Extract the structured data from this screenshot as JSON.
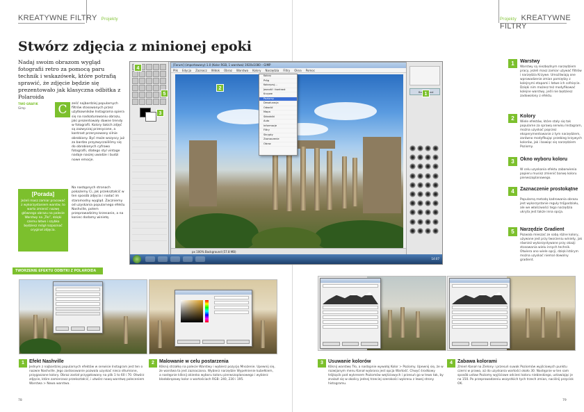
{
  "header": {
    "section": "KREATYWNE FILTRY",
    "subsection": "Projekty"
  },
  "article": {
    "title": "Stwórz zdjęcia z minionej epoki",
    "lead": "Nadaj swoim obrazom wygląd fotografii retro za pomocą paru technik i wskazówek, które potrafią sprawić, że zdjęcie będzie się prezentowało jak klasyczna odbitka z Polaroida",
    "credits_label": "TWÓ GRAFIK",
    "credits_sub": "Gimp",
    "dropcap": "C",
    "body_col1": "ześć najbardziej popularnych filtrów stosowanych przez użytkowników Instagrama opiera się na nadsaturowaniu obrazu, jaki prezentowały dawne trendy w fotografii. Kolory takich zdjęć są zazwyczaj przesycone, a kontrast przerysowany silnie obrobiony. Być może wszyscy już za bardzo przyzwyczailiśmy się do obrobionych cyfrowo fotografii, dlatego styl vintage nadaje naszej uwadze i budzi nowe emocje.",
    "body_col2": "Na następnych stronach pokażemy Ci, jak przekształcić w ten sposób zdjęcia i nadać im staromodny wygląd. Zaczniemy od uzyskania popularnego efektu Nashville, potem przeprowadzimy krzesanie, a na koniec dodamy winietę.",
    "tip_title": "[Porada]",
    "tip_text": "Jeżeli masz zamiar pracować z wykorzystaniem warstw, to warto zmienić nazwę głównego obrazu na palecie Warstwy na „Tło”, dzięki czemu łatwo i szybko będziesz mógł rozpoznać oryginał zdjęcia."
  },
  "screenshot": {
    "window_title": "[Forum] (importowany)-1.0 (Kolor RGB, 1 warstwa) 1920x1080 – GIMP",
    "menu": [
      "Plik",
      "Edycja",
      "Zaznacz",
      "Widok",
      "Obraz",
      "Warstwa",
      "Kolory",
      "Narzędzia",
      "Filtry",
      "Okna",
      "Pomoc"
    ],
    "context_menu": [
      "Kolory",
      "Próg",
      "Koloryzuj...",
      "Jasność i kontrast",
      "Krzywe",
      "Poziomy",
      "Desaturacja",
      "Odwróć",
      "Mapa",
      "Składniki",
      "Auto",
      "Informacje",
      "Filtry",
      "Skrypty",
      "Zaznaczenie",
      "Obraz"
    ],
    "status": "px  100%  Background (57.8 MB)",
    "layer_name": "Background",
    "clock": "14:07",
    "badges": [
      "4",
      "2",
      "5",
      "3",
      "1"
    ]
  },
  "side_steps": [
    {
      "num": "1",
      "title": "Warstwy",
      "text": "Warstwy są niezbędnym narzędziem pracy, jeżeli masz zamiar używać filtrów i narzędzia Krzywe. Umożliwiają one wprowadzenie zmian pomiędzy z kolejnymi etapami i łatwe ich cofnięcie. Dzięki nim możesz też modyfikować kolejne warstwy, jeśli nie będziesz zadowolony z efektu."
    },
    {
      "num": "2",
      "title": "Kolory",
      "text": "Wiele efektów, które stały się tak popularne za sprawą serwisu Instagram, można uzyskać poprzez eksperymentowanie z tym narzędziem, zarówno modyfikując przebieg krzywych kolorów, jak i bawiąc się narzędziem Poziomy."
    },
    {
      "num": "3",
      "title": "Okno wyboru koloru",
      "text": "W celu uzyskania efektu zabarwienia papieru musisz zmienić barwę koloru pierwszoplanowego."
    },
    {
      "num": "4",
      "title": "Zaznaczenie prostokątne",
      "text": "Popularną metodą kadrowania obrazu jest wykorzystanie reguły trójpodziału, ale we właściwości tego narzędzia ukryta jest także inna opcja."
    },
    {
      "num": "5",
      "title": "Narzędzie Gradient",
      "text": "Pozwala mieszać ze sobą różne kolory, używane jest przy tworzeniu winiety, jak również wykorzystywane przy okazji stosowania wielu innych technik. Otwiera ono wiele opcji, dzięki którym można uzyskać niemal dowolny gradient."
    }
  ],
  "section_bar": "TWORZENIE EFEKTU ODBITKI Z POLAROIDA",
  "steps": [
    {
      "num": "1",
      "title": "Efekt Nashville",
      "text": "Jednym z najbardziej popularnych efektów w serwisie Instagram jest ten o nazwie Nashville. Jego zastosowanie pozwala uzyskać nieco stłumione, przygaszone kolory. Obraz został przygotowany na plik 1 to 60 i 70. Otwórz zdjęcie, które zamierzasz przekształcić, i utwórz nową warstwę poleceniem Warstwa > Nowa warstwa."
    },
    {
      "num": "2",
      "title": "Malowanie w celu postarzenia",
      "text": "Kliknij strzałkę na palecie Warstwy i wybierz pozycję Mnożenie. Upewnij się, że warstwa ta jest zaznaczona. Wybierz narzędzie Wypełnienie kubełkiem, a następnie kliknij okienko wyboru koloru pierwszoplanowego i wybierz bladobrązowy kolor o wartościach RGB: 240, 230 i 195."
    },
    {
      "num": "3",
      "title": "Usuwanie kolorów",
      "text": "Kliknij warstwę Tło, a następnie wywołaj Kolor > Poziomy. Upewnij się, że w rozwijanym menu Kanał wybrana jest opcja Wartość. Chwyć środkowy trójkącik pod wykresem Poziomów wejściowych i przesuń go w lewo tak, by znalazł się w okolicy jednej trzeciej szerokości wykresu z lewej strony histogramu."
    },
    {
      "num": "4",
      "title": "Zabawa kolorami",
      "text": "Zmień Kanał na Zielony i przesuń suwak Poziomów wyjściowych punktu czerni w prawo, aż do uzyskania wartości około 30. Następnie w ten sam sposób ustaw Poziomy wyjściowe odcieni koloru niebieskiego, ustawiając je na 150. Po przeprowadzeniu wszystkich tych trzech zmian, naciśnij przycisk OK."
    }
  ],
  "page_numbers": {
    "left": "78",
    "right": "79"
  }
}
